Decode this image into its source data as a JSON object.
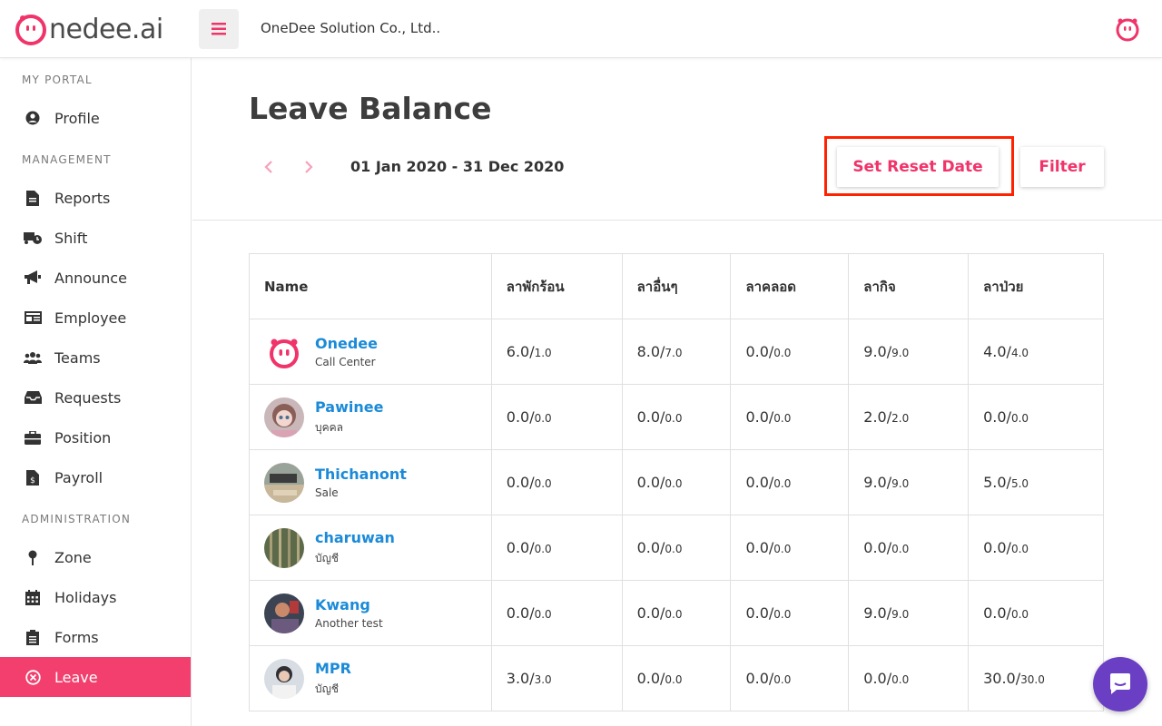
{
  "brand": {
    "logo_text_prefix": "",
    "logo_text": "nedee.ai",
    "accent": "#f0346a"
  },
  "header": {
    "company": "OneDee Solution Co., Ltd.."
  },
  "sidebar": {
    "sections": [
      {
        "title": "MY PORTAL",
        "items": [
          {
            "label": "Profile",
            "icon": "user-circle-icon"
          }
        ]
      },
      {
        "title": "MANAGEMENT",
        "items": [
          {
            "label": "Reports",
            "icon": "file-icon"
          },
          {
            "label": "Shift",
            "icon": "truck-clock-icon"
          },
          {
            "label": "Announce",
            "icon": "megaphone-icon"
          },
          {
            "label": "Employee",
            "icon": "id-card-icon"
          },
          {
            "label": "Teams",
            "icon": "users-icon"
          },
          {
            "label": "Requests",
            "icon": "inbox-icon"
          },
          {
            "label": "Position",
            "icon": "briefcase-icon"
          },
          {
            "label": "Payroll",
            "icon": "dollar-file-icon"
          }
        ]
      },
      {
        "title": "ADMINISTRATION",
        "items": [
          {
            "label": "Zone",
            "icon": "pin-icon"
          },
          {
            "label": "Holidays",
            "icon": "calendar-icon"
          },
          {
            "label": "Forms",
            "icon": "clipboard-icon"
          },
          {
            "label": "Leave",
            "icon": "x-circle-icon",
            "active": true
          }
        ]
      }
    ]
  },
  "main": {
    "title": "Leave Balance",
    "date_range": "01 Jan 2020 - 31 Dec 2020",
    "set_reset_label": "Set Reset Date",
    "filter_label": "Filter",
    "columns": [
      "Name",
      "ลาพักร้อน",
      "ลาอื่นๆ",
      "ลาคลอด",
      "ลากิจ",
      "ลาป่วย"
    ],
    "rows": [
      {
        "name": "Onedee",
        "dept": "Call Center",
        "bal": [
          [
            "6.0/",
            "1.0"
          ],
          [
            "8.0/",
            "7.0"
          ],
          [
            "0.0/",
            "0.0"
          ],
          [
            "9.0/",
            "9.0"
          ],
          [
            "4.0/",
            "4.0"
          ]
        ]
      },
      {
        "name": "Pawinee",
        "dept": "บุคคล",
        "bal": [
          [
            "0.0/",
            "0.0"
          ],
          [
            "0.0/",
            "0.0"
          ],
          [
            "0.0/",
            "0.0"
          ],
          [
            "2.0/",
            "2.0"
          ],
          [
            "0.0/",
            "0.0"
          ]
        ]
      },
      {
        "name": "Thichanont",
        "dept": "Sale",
        "bal": [
          [
            "0.0/",
            "0.0"
          ],
          [
            "0.0/",
            "0.0"
          ],
          [
            "0.0/",
            "0.0"
          ],
          [
            "9.0/",
            "9.0"
          ],
          [
            "5.0/",
            "5.0"
          ]
        ]
      },
      {
        "name": "charuwan",
        "dept": "บัญชี",
        "bal": [
          [
            "0.0/",
            "0.0"
          ],
          [
            "0.0/",
            "0.0"
          ],
          [
            "0.0/",
            "0.0"
          ],
          [
            "0.0/",
            "0.0"
          ],
          [
            "0.0/",
            "0.0"
          ]
        ]
      },
      {
        "name": "Kwang",
        "dept": "Another test",
        "bal": [
          [
            "0.0/",
            "0.0"
          ],
          [
            "0.0/",
            "0.0"
          ],
          [
            "0.0/",
            "0.0"
          ],
          [
            "9.0/",
            "9.0"
          ],
          [
            "0.0/",
            "0.0"
          ]
        ]
      },
      {
        "name": "MPR",
        "dept": "บัญชี",
        "bal": [
          [
            "3.0/",
            "3.0"
          ],
          [
            "0.0/",
            "0.0"
          ],
          [
            "0.0/",
            "0.0"
          ],
          [
            "0.0/",
            "0.0"
          ],
          [
            "30.0/",
            "30.0"
          ]
        ]
      }
    ]
  }
}
